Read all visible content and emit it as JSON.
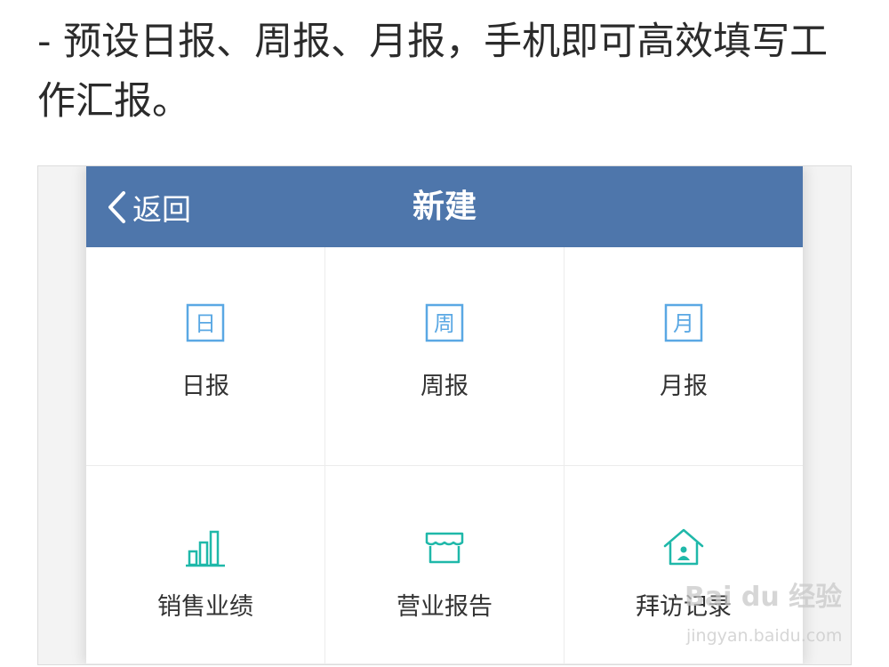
{
  "caption": "- 预设日报、周报、月报，手机即可高效填写工作汇报。",
  "navbar": {
    "back_label": "返回",
    "title": "新建",
    "background": "#4e76ab"
  },
  "items": [
    {
      "label": "日报",
      "icon": "calendar-day-icon",
      "glyph": "日",
      "color": "#5aa8e4"
    },
    {
      "label": "周报",
      "icon": "calendar-week-icon",
      "glyph": "周",
      "color": "#5aa8e4"
    },
    {
      "label": "月报",
      "icon": "calendar-month-icon",
      "glyph": "月",
      "color": "#5aa8e4"
    },
    {
      "label": "销售业绩",
      "icon": "bar-chart-icon",
      "color": "#1fb8a9"
    },
    {
      "label": "营业报告",
      "icon": "storefront-icon",
      "color": "#1fb8a9"
    },
    {
      "label": "拜访记录",
      "icon": "home-person-icon",
      "color": "#1fb8a9"
    }
  ],
  "watermark": {
    "text": "Bai du 经验",
    "sub": "jingyan.baidu.com"
  }
}
